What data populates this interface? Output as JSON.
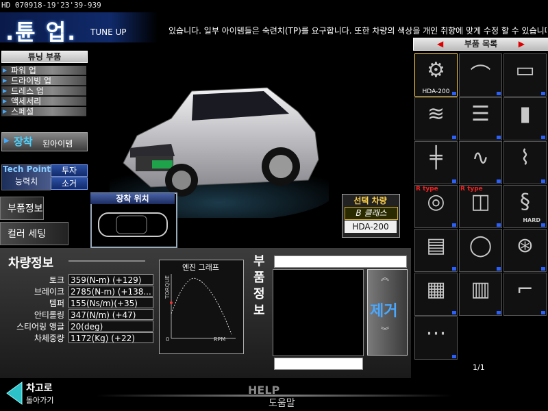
{
  "hud": {
    "id_text": "HD 070918-19'23'39-939"
  },
  "header": {
    "title_ko": ".튠 업.",
    "title_en": "TUNE UP",
    "ticker": "있습니다. 일부 아이템들은 숙련치(TP)를 요구합니다. 또한 차량의 색상을 개인 취향에 맞게 수정 할 수 있습니다."
  },
  "sidebar": {
    "parts_heading": "튜닝 부품",
    "items": [
      {
        "label": "파워 업"
      },
      {
        "label": "드라이빙 업"
      },
      {
        "label": "드레스 업"
      },
      {
        "label": "액세서리"
      },
      {
        "label": "스페셜"
      }
    ],
    "equipped_big": "장착",
    "equipped_small": "된아이템",
    "tech_point_title": "Tech Point",
    "tech_point_sub": "능력치",
    "invest_label": "투자",
    "recover_label": "소거",
    "parts_info_tab": "부품정보",
    "color_setting_tab": "컬러 세팅"
  },
  "mount": {
    "title": "장착 위치"
  },
  "selected_car": {
    "title": "선택 차량",
    "class": "B 클래스",
    "model": "HDA-200"
  },
  "vehicle_info": {
    "title": "차량정보",
    "stats": [
      {
        "label": "토크",
        "value": "359(N-m) (+129)"
      },
      {
        "label": "브레이크",
        "value": "2785(N-m) (+138..."
      },
      {
        "label": "템퍼",
        "value": "155(Ns/m)(+35)"
      },
      {
        "label": "안티롤링",
        "value": "347(N/m) (+47)"
      },
      {
        "label": "스티어링 앵글",
        "value": "20(deg)"
      },
      {
        "label": "차체중량",
        "value": "1172(Kg) (+22)"
      }
    ]
  },
  "engine_graph": {
    "title": "엔진 그래프",
    "y_label": "TORQUE",
    "x_label": "RPM",
    "origin": "0"
  },
  "part_info": {
    "title": "부품정보",
    "remove_label": "제거"
  },
  "parts_list": {
    "heading": "부품 목록",
    "page": "1/1",
    "items": [
      {
        "icon": "engine-icon",
        "label": "HDA-200"
      },
      {
        "icon": "intake-pipe-icon",
        "label": ""
      },
      {
        "icon": "oil-pan-icon",
        "label": ""
      },
      {
        "icon": "exhaust-manifold-icon",
        "label": ""
      },
      {
        "icon": "intake-manifold-icon",
        "label": ""
      },
      {
        "icon": "brake-fluid-icon",
        "label": ""
      },
      {
        "icon": "strut-bar-icon",
        "label": ""
      },
      {
        "icon": "brake-lines-icon",
        "label": ""
      },
      {
        "icon": "coilover-icon",
        "label": ""
      },
      {
        "icon": "brake-rotor-icon",
        "label": "R type"
      },
      {
        "icon": "brake-pads-icon",
        "label": "R type"
      },
      {
        "icon": "spring-icon",
        "label": "HARD"
      },
      {
        "icon": "ecu-icon",
        "label": ""
      },
      {
        "icon": "tire-icon",
        "label": ""
      },
      {
        "icon": "throttle-body-icon",
        "label": ""
      },
      {
        "icon": "oil-cooler-icon",
        "label": ""
      },
      {
        "icon": "intercooler-icon",
        "label": ""
      },
      {
        "icon": "spoiler-icon",
        "label": ""
      },
      {
        "icon": "camshaft-icon",
        "label": ""
      }
    ]
  },
  "footer": {
    "back_label": "차고로",
    "back_sub": "돌아가기",
    "help_en": "HELP",
    "help_ko": "도움말"
  },
  "colors": {
    "accent": "#4aa8ff",
    "brand": "#102a6a",
    "car": "#c8c8cc"
  }
}
